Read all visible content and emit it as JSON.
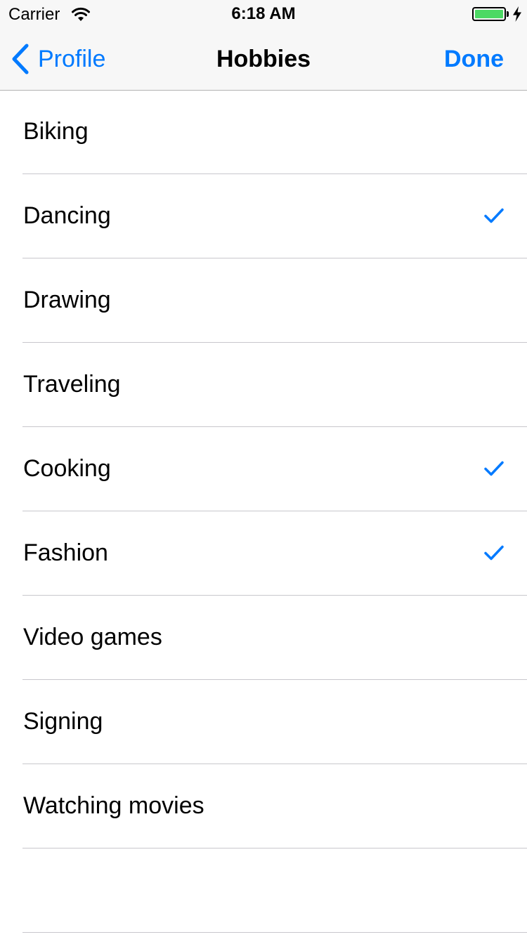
{
  "status_bar": {
    "carrier": "Carrier",
    "time": "6:18 AM"
  },
  "nav": {
    "back_label": "Profile",
    "title": "Hobbies",
    "done_label": "Done"
  },
  "colors": {
    "accent": "#007aff",
    "battery": "#4cd964",
    "separator": "#c8c7cc",
    "bar_background": "#f7f7f7"
  },
  "hobbies": [
    {
      "label": "Biking",
      "checked": false
    },
    {
      "label": "Dancing",
      "checked": true
    },
    {
      "label": "Drawing",
      "checked": false
    },
    {
      "label": "Traveling",
      "checked": false
    },
    {
      "label": "Cooking",
      "checked": true
    },
    {
      "label": "Fashion",
      "checked": true
    },
    {
      "label": "Video games",
      "checked": false
    },
    {
      "label": "Signing",
      "checked": false
    },
    {
      "label": "Watching movies",
      "checked": false
    },
    {
      "label": "",
      "checked": false
    }
  ]
}
